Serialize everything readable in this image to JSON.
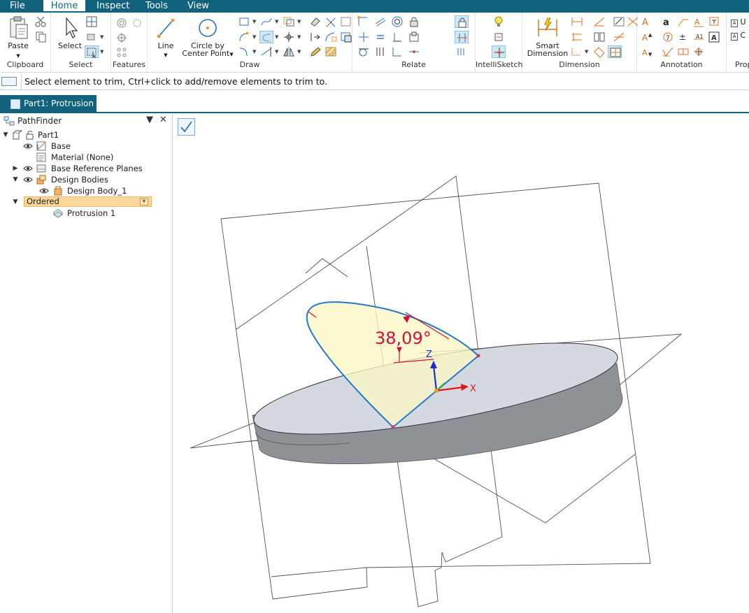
{
  "menu": {
    "tabs": [
      "File",
      "Home",
      "Inspect",
      "Tools",
      "View"
    ],
    "active": "Home"
  },
  "ribbon": {
    "clipboard": {
      "label": "Clipboard",
      "paste": "Paste"
    },
    "select": {
      "label": "Select",
      "select_btn": "Select"
    },
    "features": {
      "label": "Features"
    },
    "draw": {
      "label": "Draw",
      "line": "Line",
      "circle_line1": "Circle by",
      "circle_line2": "Center Point"
    },
    "relate": {
      "label": "Relate"
    },
    "intellisketch": {
      "label": "IntelliSketch"
    },
    "dimension": {
      "label": "Dimension",
      "smart_line1": "Smart",
      "smart_line2": "Dimension"
    },
    "annotation": {
      "label": "Annotation"
    },
    "properties": {
      "label": "Prop"
    },
    "cut_u": "U",
    "cut_c": "C"
  },
  "prompt": {
    "text": "Select element to trim, Ctrl+click to add/remove elements to trim to."
  },
  "document_tab": {
    "title": "Part1: Protrusion"
  },
  "pathfinder": {
    "title": "PathFinder",
    "part": "Part1",
    "base": "Base",
    "material": "Material (None)",
    "base_planes": "Base Reference Planes",
    "design_bodies": "Design Bodies",
    "design_body": "Design Body_1",
    "ordered": "Ordered",
    "protrusion": "Protrusion 1"
  },
  "viewport": {
    "dimension_value": "38,09°",
    "axis_z": "Z",
    "axis_x": "X"
  },
  "colors": {
    "accent": "#12627e",
    "ordered_bg": "#fbd79b",
    "profile": "#2379c8",
    "dimension": "#d0103a"
  }
}
